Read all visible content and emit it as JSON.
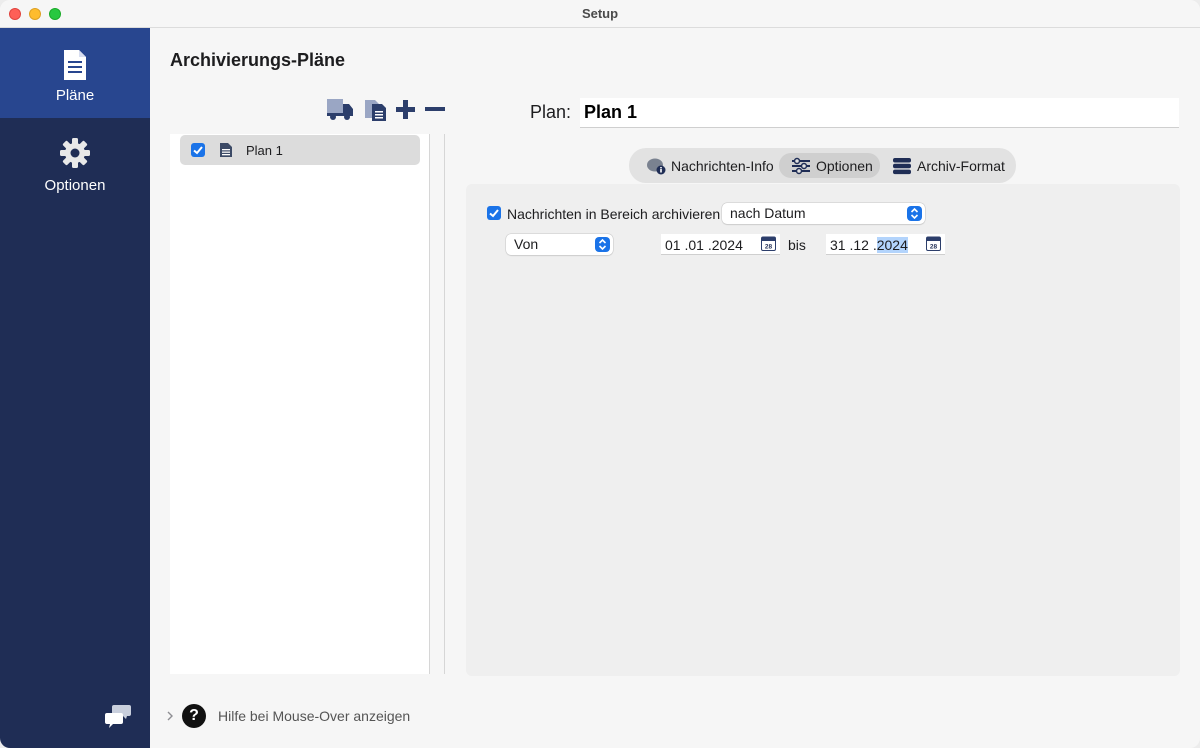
{
  "window": {
    "title": "Setup"
  },
  "sidebar": {
    "items": [
      {
        "label": "Pläne",
        "icon": "document-icon",
        "active": true
      },
      {
        "label": "Optionen",
        "icon": "gear-icon",
        "active": false
      }
    ],
    "footer_icon": "chat-bubbles-icon"
  },
  "main": {
    "title": "Archivierungs-Pläne",
    "toolbar": {
      "icons": [
        "truck-icon",
        "duplicate-icon",
        "plus-icon",
        "minus-icon"
      ]
    },
    "plans": [
      {
        "label": "Plan 1",
        "checked": true,
        "icon": "document-icon"
      }
    ],
    "plan_field": {
      "label": "Plan:",
      "value": "Plan 1"
    },
    "tabs": [
      {
        "label": "Nachrichten-Info",
        "icon": "message-info-icon",
        "active": false
      },
      {
        "label": "Optionen",
        "icon": "sliders-icon",
        "active": true
      },
      {
        "label": "Archiv-Format",
        "icon": "database-icon",
        "active": false
      }
    ],
    "options": {
      "archive_range": {
        "checked": true,
        "label": "Nachrichten in Bereich archivieren:",
        "mode": "nach Datum"
      },
      "range_type": "Von",
      "date_from": {
        "day": "01",
        "month": "01",
        "year": "2024"
      },
      "separator": "bis",
      "date_to": {
        "day": "31",
        "month": "12",
        "year": "2024"
      },
      "calendar_day": "28"
    }
  },
  "footer": {
    "help_text": "Hilfe bei Mouse-Over anzeigen",
    "help_symbol": "?"
  },
  "colors": {
    "sidebar": "#1f2d55",
    "sidebar_active": "#28468f",
    "accent": "#1a73e8"
  }
}
